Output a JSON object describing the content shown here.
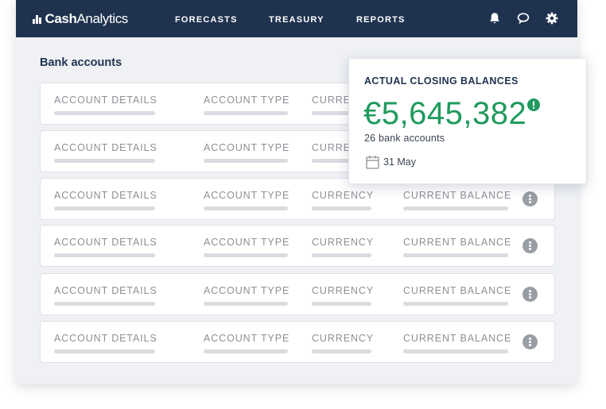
{
  "app": {
    "brand_prefix": "Cash",
    "brand_suffix": "Analytics"
  },
  "nav": {
    "items": [
      {
        "label": "FORECASTS"
      },
      {
        "label": "TREASURY"
      },
      {
        "label": "REPORTS"
      }
    ],
    "icons": [
      "bell-icon",
      "chat-icon",
      "gear-icon"
    ]
  },
  "bank_accounts": {
    "title": "Bank accounts",
    "columns": {
      "account_details": "ACCOUNT DETAILS",
      "account_type": "ACCOUNT TYPE",
      "currency": "CURRENCY",
      "current_balance": "CURRENT BALANCE"
    },
    "visible_labels": {
      "currency_truncated": "CURRENC"
    },
    "row_count": 6
  },
  "closing_balance_card": {
    "title": "ACTUAL CLOSING BALANCES",
    "amount": "€5,645,382",
    "accounts_text": "26 bank accounts",
    "date": "31 May",
    "colors": {
      "amount": "#1f9a5d",
      "alert": "#1f9a5d"
    }
  },
  "colors": {
    "topbar": "#1f334f",
    "page_background": "#eff1f5",
    "title_text": "#1f334f",
    "placeholder_bar": "#d9dce0"
  }
}
